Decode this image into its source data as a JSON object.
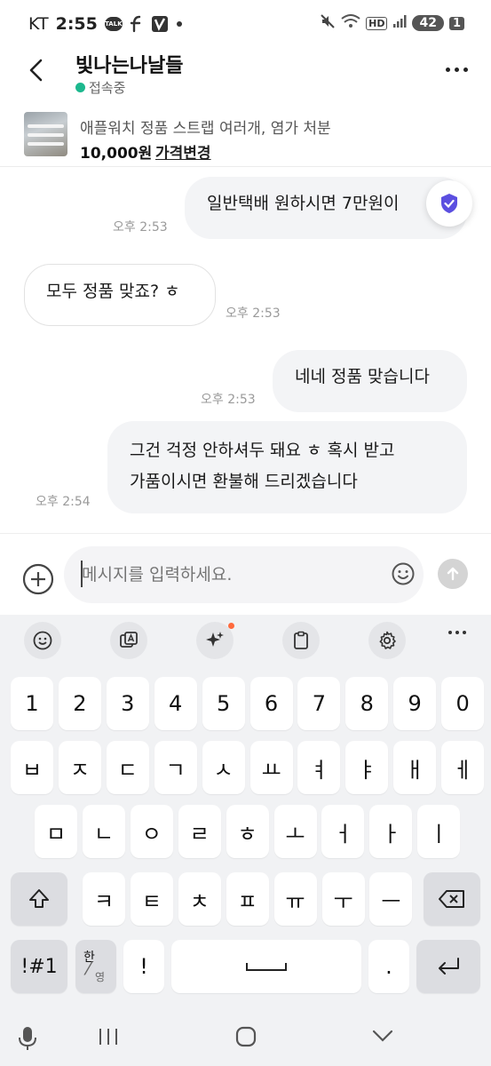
{
  "status_bar": {
    "carrier": "KT",
    "time": "2:55",
    "talk_badge": "TALK",
    "hd_label": "HD",
    "battery": "42",
    "notif_count": "1"
  },
  "header": {
    "title": "빛나는나날들",
    "presence": "접속중"
  },
  "product": {
    "title": "애플워치 정품 스트랩 여러개, 염가 처분",
    "price": "10,000원",
    "price_change_label": "가격변경"
  },
  "messages": [
    {
      "side": "out",
      "text": "일반택배 원하시면 7만원이",
      "time": "오후 2:53"
    },
    {
      "side": "in",
      "text": "모두 정품 맞죠? ㅎ",
      "time": "오후 2:53"
    },
    {
      "side": "out",
      "text": "네네 정품 맞습니다",
      "time": "오후 2:53"
    },
    {
      "side": "out",
      "text_line1": "그건 걱정 안하셔두 돼요 ㅎ 혹시 받고",
      "text_line2": "가품이시면 환불해 드리겠습니다",
      "time": "오후 2:54"
    }
  ],
  "input": {
    "placeholder": "메시지를 입력하세요."
  },
  "keyboard": {
    "row_numbers": [
      "1",
      "2",
      "3",
      "4",
      "5",
      "6",
      "7",
      "8",
      "9",
      "0"
    ],
    "row1": [
      "ㅂ",
      "ㅈ",
      "ㄷ",
      "ㄱ",
      "ㅅ",
      "ㅛ",
      "ㅕ",
      "ㅑ",
      "ㅐ",
      "ㅔ"
    ],
    "row2": [
      "ㅁ",
      "ㄴ",
      "ㅇ",
      "ㄹ",
      "ㅎ",
      "ㅗ",
      "ㅓ",
      "ㅏ",
      "ㅣ"
    ],
    "row3": [
      "ㅋ",
      "ㅌ",
      "ㅊ",
      "ㅍ",
      "ㅠ",
      "ㅜ",
      "ㅡ"
    ],
    "symbols_key": "!#1",
    "lang_key_top": "한",
    "lang_key_bottom": "영",
    "exclaim_key": "!",
    "period_key": "."
  },
  "colors": {
    "presence_green": "#1cb88e",
    "shield_purple": "#5b4fe0",
    "notification_dot": "#ff6a3d"
  }
}
